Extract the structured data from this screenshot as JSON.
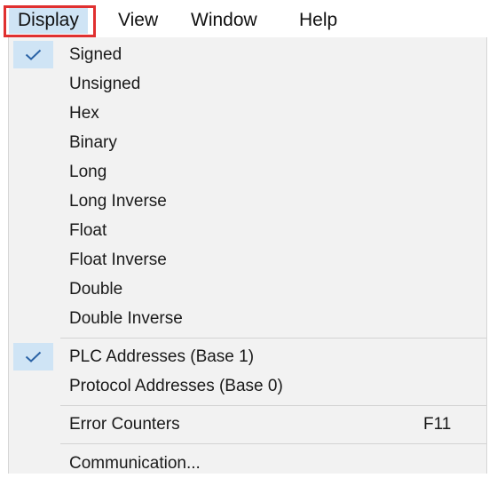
{
  "menubar": {
    "items": [
      {
        "label": "Display"
      },
      {
        "label": "View"
      },
      {
        "label": "Window"
      },
      {
        "label": "Help"
      }
    ]
  },
  "display_menu": {
    "display_format_group": [
      {
        "label": "Signed",
        "checked": true
      },
      {
        "label": "Unsigned",
        "checked": false
      },
      {
        "label": "Hex",
        "checked": false
      },
      {
        "label": "Binary",
        "checked": false
      },
      {
        "label": "Long",
        "checked": false
      },
      {
        "label": "Long Inverse",
        "checked": false
      },
      {
        "label": "Float",
        "checked": false
      },
      {
        "label": "Float Inverse",
        "checked": false
      },
      {
        "label": "Double",
        "checked": false
      },
      {
        "label": "Double Inverse",
        "checked": false
      }
    ],
    "address_group": [
      {
        "label": "PLC Addresses (Base 1)",
        "checked": true
      },
      {
        "label": "Protocol Addresses (Base 0)",
        "checked": false
      }
    ],
    "error_counters": {
      "label": "Error Counters",
      "shortcut": "F11"
    },
    "communication": {
      "label": "Communication..."
    }
  },
  "colors": {
    "highlight": "#cfe4f5",
    "annotation_box": "#e03030",
    "menu_background": "#f2f2f2",
    "checkmark": "#2b63a6"
  }
}
